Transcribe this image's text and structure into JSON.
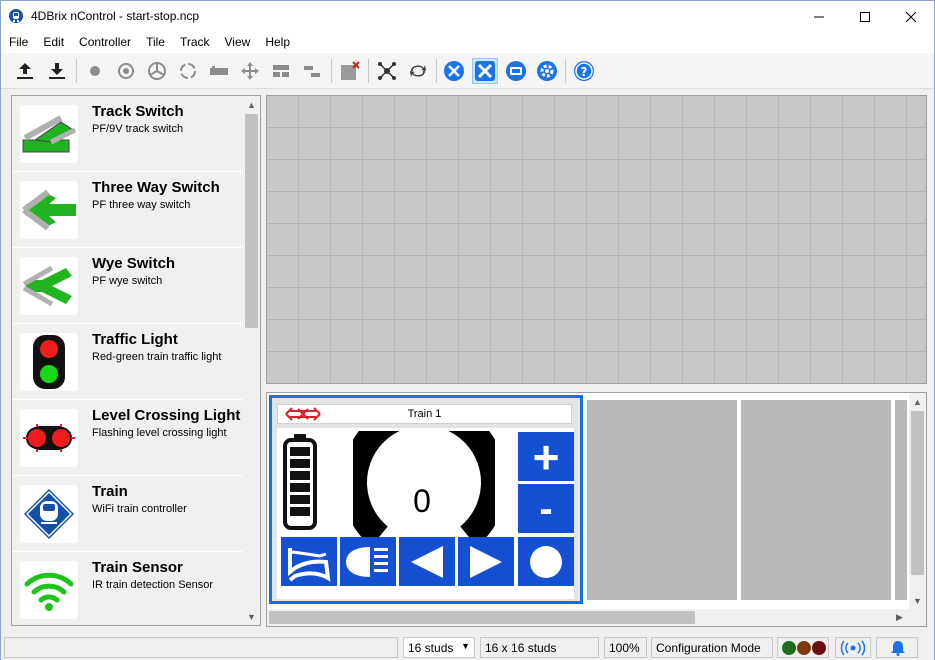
{
  "window": {
    "title": "4DBrix nControl - start-stop.ncp",
    "controls": [
      "minimize-icon",
      "maximize-icon",
      "close-icon"
    ]
  },
  "menu": {
    "items": [
      "File",
      "Edit",
      "Controller",
      "Tile",
      "Track",
      "View",
      "Help"
    ]
  },
  "toolbar": {
    "buttons": [
      "upload-icon",
      "download-icon",
      "sensor-dot-icon",
      "target-icon",
      "turntable-icon",
      "rotate-circle-icon",
      "track-piece-icon",
      "crossing-icon",
      "split-tile-icon",
      "split-tile-2-icon",
      "delete-tile-icon",
      "network-icon",
      "refresh-icon",
      "wrench-screwdriver-icon",
      "tools-icon",
      "controller-icon",
      "settings-gear-icon",
      "help-icon"
    ],
    "active": "tools-icon",
    "accent": "#1a73e8"
  },
  "palette": {
    "items": [
      {
        "title": "Track Switch",
        "description": "PF/9V track switch",
        "icon": "track-switch-icon"
      },
      {
        "title": "Three Way Switch",
        "description": "PF three way switch",
        "icon": "three-way-switch-icon"
      },
      {
        "title": "Wye Switch",
        "description": "PF wye switch",
        "icon": "wye-switch-icon"
      },
      {
        "title": "Traffic Light",
        "description": "Red-green train traffic light",
        "icon": "traffic-light-icon"
      },
      {
        "title": "Level Crossing Light",
        "description": "Flashing level crossing light",
        "icon": "level-crossing-light-icon"
      },
      {
        "title": "Train",
        "description": "WiFi train controller",
        "icon": "train-icon"
      },
      {
        "title": "Train Sensor",
        "description": "IR train detection Sensor",
        "icon": "train-sensor-icon"
      }
    ]
  },
  "train_controller": {
    "name": "Train 1",
    "speed": "0",
    "plus_label": "+",
    "minus_label": "-",
    "buttons": [
      "horn-icon",
      "headlight-icon",
      "reverse-icon",
      "forward-icon",
      "stop-icon"
    ],
    "colors": {
      "button": "#1650d2",
      "selected_border": "#1a6fe0",
      "logo": "#d2232a"
    }
  },
  "statusbar": {
    "left_text": "",
    "grid_size": "16 studs",
    "tile_size": "16 x 16 studs",
    "zoom": "100%",
    "mode": "Configuration Mode",
    "status_lights": [
      "#1e6b1e",
      "#7a3b0a",
      "#6b1010"
    ],
    "wifi_icon": "wifi-signal-icon",
    "bell_icon": "bell-icon"
  }
}
